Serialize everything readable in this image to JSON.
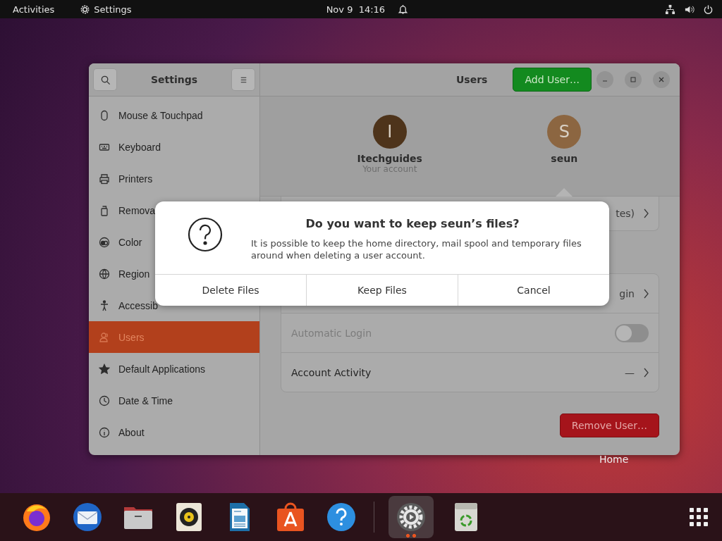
{
  "top_bar": {
    "activities": "Activities",
    "app_menu": "Settings",
    "clock": "Nov 9  14:16"
  },
  "window": {
    "sidebar_title": "Settings",
    "title": "Users",
    "add_button": "Add User…"
  },
  "sidebar": {
    "items": [
      {
        "label": "Mouse & Touchpad",
        "selected": false
      },
      {
        "label": "Keyboard",
        "selected": false
      },
      {
        "label": "Printers",
        "selected": false
      },
      {
        "label": "Remova",
        "selected": false
      },
      {
        "label": "Color",
        "selected": false
      },
      {
        "label": "Region",
        "selected": false
      },
      {
        "label": "Accessib",
        "selected": false
      },
      {
        "label": "Users",
        "selected": true
      },
      {
        "label": "Default Applications",
        "selected": false
      },
      {
        "label": "Date & Time",
        "selected": false
      },
      {
        "label": "About",
        "selected": false
      }
    ]
  },
  "users": [
    {
      "initial": "I",
      "name": "Itechguides",
      "subtitle": "Your account",
      "color": "#4e341b",
      "selected": false
    },
    {
      "initial": "S",
      "name": "seun",
      "color": "#8c6641",
      "selected": true
    }
  ],
  "setting_groups": [
    [
      {
        "kind": "link",
        "value": "tes)"
      }
    ],
    [
      {
        "kind": "link",
        "value": "gin"
      },
      {
        "kind": "toggle",
        "label": "Automatic Login",
        "on": false,
        "disabled": true
      },
      {
        "kind": "link",
        "label": "Account Activity",
        "value": "—"
      }
    ]
  ],
  "remove_button": "Remove User…",
  "dialog": {
    "title": "Do you want to keep seun’s files?",
    "message": "It is possible to keep the home directory, mail spool and temporary files around when deleting a user account.",
    "buttons": [
      "Delete Files",
      "Keep Files",
      "Cancel"
    ]
  },
  "desktop_icons": [
    {
      "label": "Home"
    }
  ],
  "dock": {
    "apps": [
      {
        "kind": "browser",
        "running": false
      },
      {
        "kind": "mail",
        "running": false
      },
      {
        "kind": "folder",
        "running": false
      },
      {
        "kind": "speaker",
        "running": false
      },
      {
        "kind": "document",
        "running": false
      },
      {
        "kind": "bag",
        "running": false
      },
      {
        "kind": "help",
        "running": false
      },
      {
        "kind": "gear",
        "running": true
      },
      {
        "kind": "trash",
        "running": false
      }
    ]
  }
}
